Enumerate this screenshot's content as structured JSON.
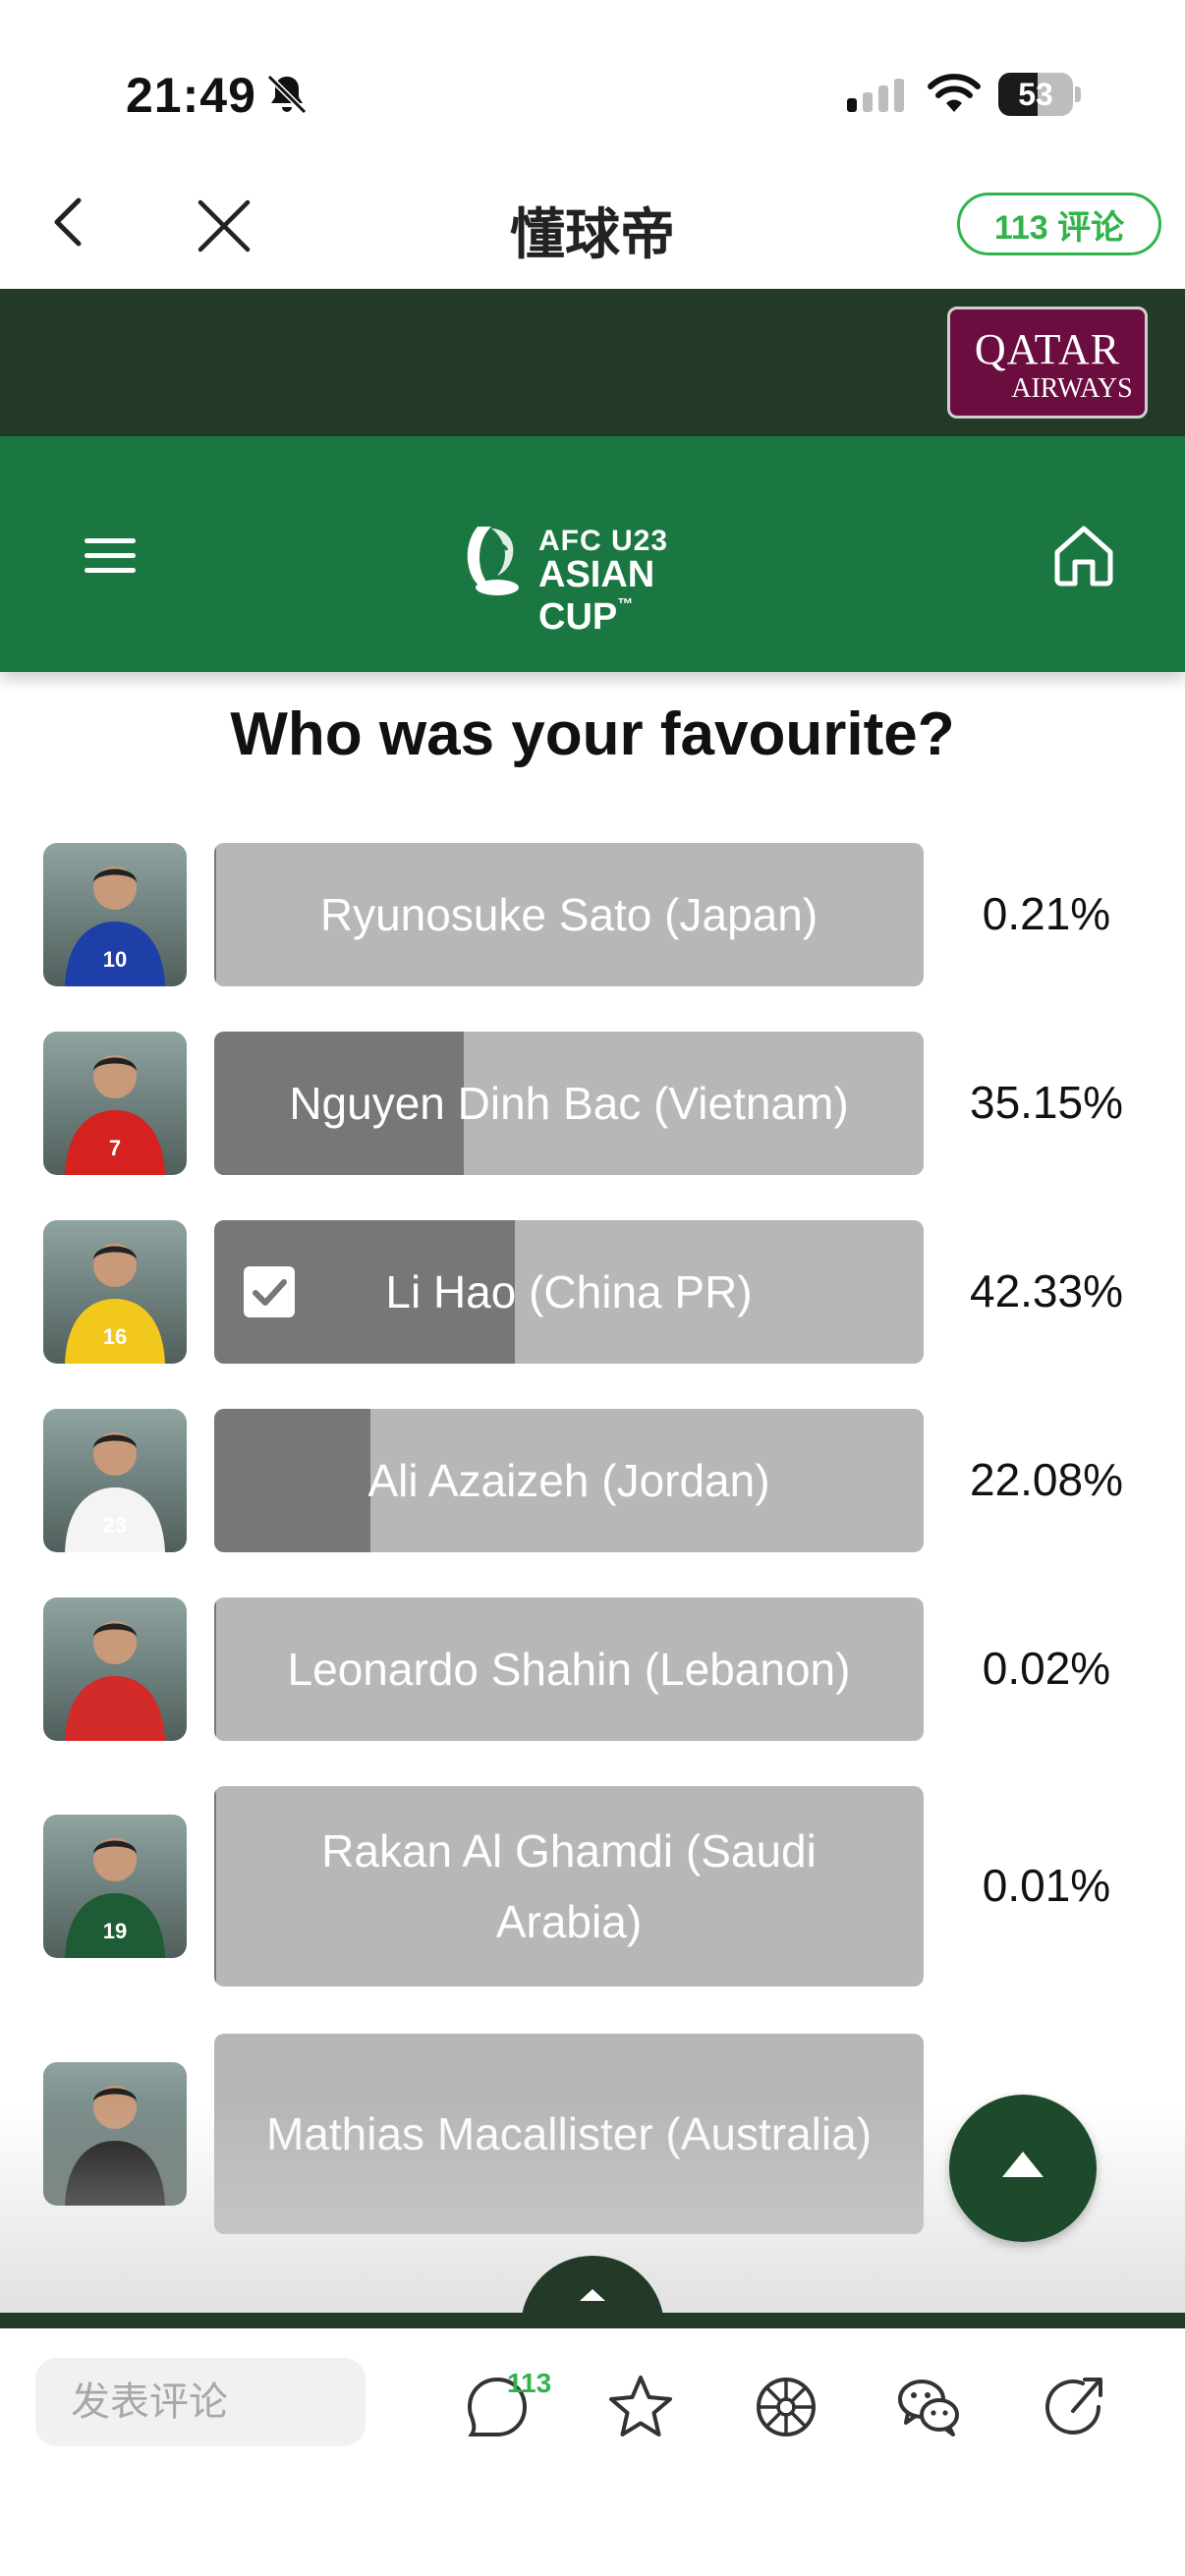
{
  "status_bar": {
    "time": "21:49",
    "battery": "53",
    "battery_level": 0.53
  },
  "nav": {
    "title": "懂球帝",
    "comments_button": "113 评论"
  },
  "sponsor": {
    "brand_line1": "QATAR",
    "brand_line2": "AIRWAYS"
  },
  "header": {
    "logo_line1": "AFC U23",
    "logo_line2": "ASIAN CUP",
    "logo_tm": "™"
  },
  "poll": {
    "title": "Who was your favourite?",
    "options": [
      {
        "label": "Ryunosuke Sato (Japan)",
        "percent": "0.21%",
        "share": 0.0021,
        "selected": false,
        "jersey": "10",
        "kit": "#1f3fa8"
      },
      {
        "label": "Nguyen Dinh Bac (Vietnam)",
        "percent": "35.15%",
        "share": 0.3515,
        "selected": false,
        "jersey": "7",
        "kit": "#d5211f"
      },
      {
        "label": "Li Hao (China PR)",
        "percent": "42.33%",
        "share": 0.4233,
        "selected": true,
        "jersey": "16",
        "kit": "#f2c81c"
      },
      {
        "label": "Ali Azaizeh (Jordan)",
        "percent": "22.08%",
        "share": 0.2208,
        "selected": false,
        "jersey": "23",
        "kit": "#f4f4f4"
      },
      {
        "label": "Leonardo Shahin (Lebanon)",
        "percent": "0.02%",
        "share": 0.0002,
        "selected": false,
        "jersey": "",
        "kit": "#d32a2a"
      },
      {
        "label": "Rakan Al Ghamdi (Saudi Arabia)",
        "percent": "0.01%",
        "share": 0.0001,
        "selected": false,
        "jersey": "19",
        "kit": "#1d5c35"
      },
      {
        "label": "Mathias Macallister (Australia)",
        "percent": "",
        "share": 0,
        "selected": false,
        "jersey": "",
        "kit": "#151515"
      }
    ]
  },
  "toolbar": {
    "comment_placeholder": "发表评论",
    "comment_count": "113"
  },
  "colors": {
    "brand_green": "#1a7741",
    "dark_green": "#223a27",
    "accent": "#2fb34a",
    "qatar": "#6b0d3f",
    "bar_bg": "#b7b7b7",
    "bar_fill": "#777777"
  }
}
